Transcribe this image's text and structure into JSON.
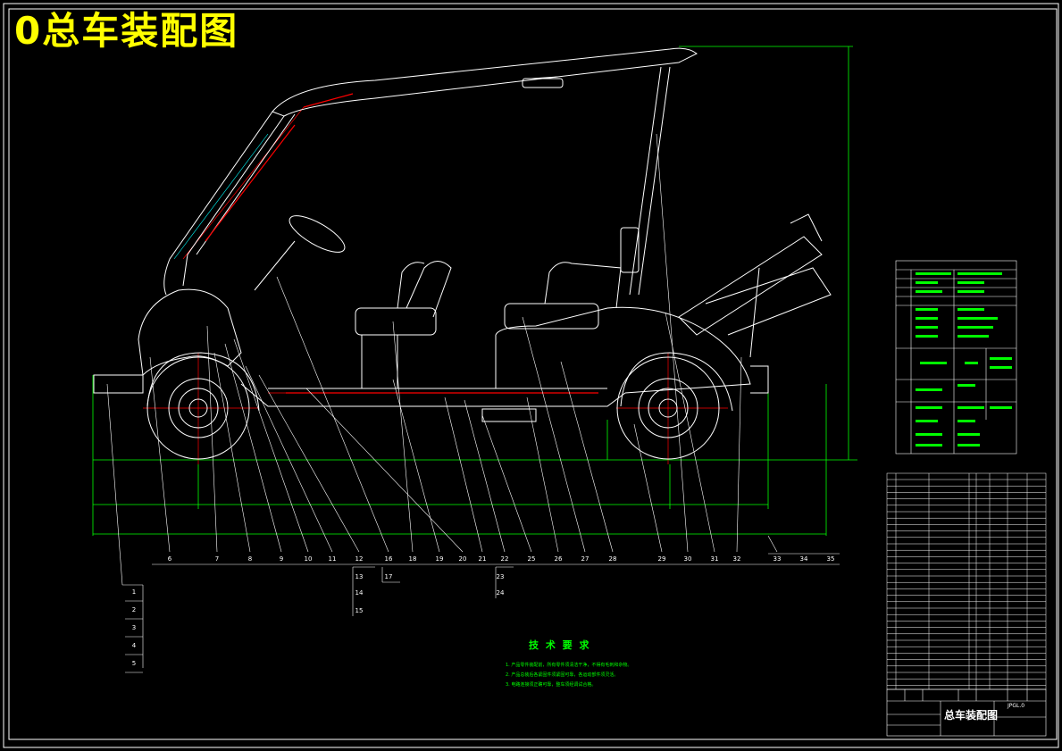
{
  "title": "0总车装配图",
  "callouts_top_row": [
    "6",
    "7",
    "8",
    "9",
    "10",
    "11",
    "12",
    "13",
    "14",
    "15",
    "16",
    "17",
    "18",
    "19",
    "20",
    "21",
    "22",
    "23",
    "24",
    "25",
    "26",
    "27",
    "28",
    "29",
    "30",
    "31",
    "32",
    "33",
    "34",
    "35"
  ],
  "callouts_left_column": [
    "1",
    "2",
    "3",
    "4",
    "5"
  ],
  "tech_requirements": {
    "heading": "技 术 要 求",
    "notes": [
      "1. 产品零件装配前，所有零件须清洁干净，不得有毛刺和杂物。",
      "2. 产品总装后各紧固件须紧固可靠，各运动部件须灵活。",
      "3. 电路连接须正确可靠，整车须经调试合格。"
    ]
  },
  "title_block": {
    "drawing_title": "总车装配图",
    "drawing_code": "JPGL.0"
  },
  "colors": {
    "background": "#000000",
    "lines": "#ffffff",
    "dimensions": "#00ff00",
    "centerlines": "#ff0000",
    "title": "#ffff00",
    "accent_cyan": "#00ffff"
  }
}
